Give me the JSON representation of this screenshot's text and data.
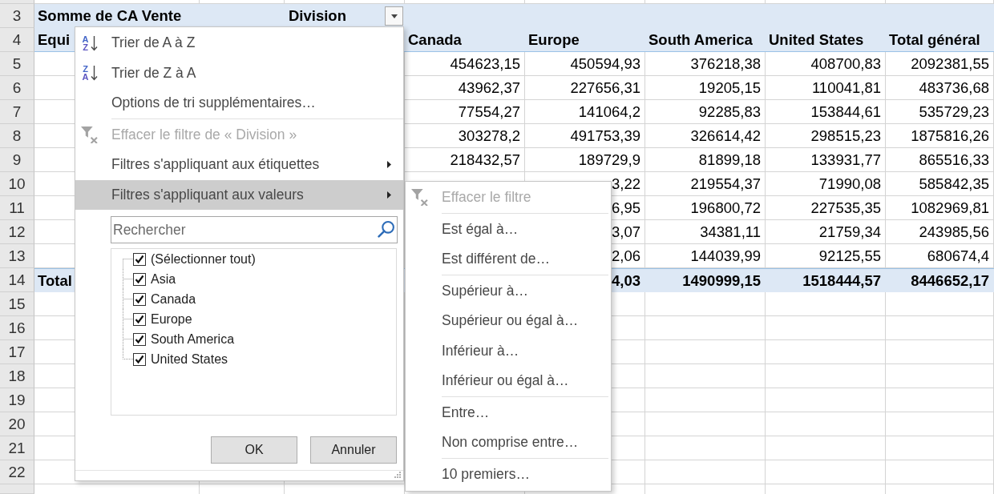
{
  "sheet": {
    "row_numbers": [
      "3",
      "4",
      "5",
      "6",
      "7",
      "8",
      "9",
      "10",
      "11",
      "12",
      "13",
      "14",
      "15",
      "16",
      "17",
      "18",
      "19",
      "20",
      "21",
      "22"
    ],
    "pivot": {
      "title": "Somme de CA Vente",
      "column_field": "Division",
      "row_field": "Equi",
      "columns": [
        "Canada",
        "Europe",
        "South America",
        "United States",
        "Total général"
      ],
      "rows": [
        {
          "values": [
            "454623,15",
            "450594,93",
            "376218,38",
            "408700,83",
            "2092381,55"
          ]
        },
        {
          "values": [
            "43962,37",
            "227656,31",
            "19205,15",
            "110041,81",
            "483736,68"
          ]
        },
        {
          "values": [
            "77554,27",
            "141064,2",
            "92285,83",
            "153844,61",
            "535729,23"
          ]
        },
        {
          "values": [
            "303278,2",
            "491753,39",
            "326614,42",
            "298515,23",
            "1875816,26"
          ]
        },
        {
          "values": [
            "218432,57",
            "189729,9",
            "81899,18",
            "133931,77",
            "865516,33"
          ]
        },
        {
          "values": [
            "3,22",
            "219554,37",
            "71990,08",
            "585842,35"
          ]
        },
        {
          "values": [
            "6,95",
            "196800,72",
            "227535,35",
            "1082969,81"
          ]
        },
        {
          "values": [
            "3,07",
            "34381,11",
            "21759,34",
            "243985,56"
          ]
        },
        {
          "values": [
            "2,06",
            "144039,99",
            "92125,55",
            "680674,4"
          ]
        }
      ],
      "total": {
        "label": "Total",
        "values": [
          "4,03",
          "1490999,15",
          "1518444,57",
          "8446652,17"
        ]
      }
    }
  },
  "filter_menu": {
    "sections": [
      [
        {
          "kind": "sort",
          "label": "Trier de A à Z",
          "icon_letters": [
            "A",
            "Z"
          ],
          "disabled": false,
          "selected": false,
          "submenu": false
        },
        {
          "kind": "sort",
          "label": "Trier de Z à A",
          "icon_letters": [
            "Z",
            "A"
          ],
          "disabled": false,
          "selected": false,
          "submenu": false
        },
        {
          "kind": "command",
          "label": "Options de tri supplémentaires…",
          "disabled": false,
          "selected": false,
          "submenu": false
        }
      ],
      [
        {
          "kind": "clear_filter",
          "label": "Effacer le filtre de « Division »",
          "disabled": true,
          "selected": false,
          "submenu": false
        },
        {
          "kind": "command",
          "label": "Filtres s'appliquant aux étiquettes",
          "disabled": false,
          "selected": false,
          "submenu": true
        },
        {
          "kind": "command",
          "label": "Filtres s'appliquant aux valeurs",
          "disabled": false,
          "selected": true,
          "submenu": true
        }
      ]
    ],
    "search": {
      "placeholder": "Rechercher"
    },
    "values": [
      {
        "label": "(Sélectionner tout)",
        "checked": true
      },
      {
        "label": "Asia",
        "checked": true
      },
      {
        "label": "Canada",
        "checked": true
      },
      {
        "label": "Europe",
        "checked": true
      },
      {
        "label": "South America",
        "checked": true
      },
      {
        "label": "United States",
        "checked": true
      }
    ],
    "buttons": [
      "OK",
      "Annuler"
    ],
    "submenu": {
      "sections": [
        [
          {
            "kind": "clear_filter",
            "label": "Effacer le filtre",
            "disabled": true,
            "selected": false,
            "submenu": false
          }
        ],
        [
          {
            "kind": "command",
            "label": "Est égal à…",
            "disabled": false,
            "selected": false,
            "submenu": false
          },
          {
            "kind": "command",
            "label": "Est différent de…",
            "disabled": false,
            "selected": false,
            "submenu": false
          }
        ],
        [
          {
            "kind": "command",
            "label": "Supérieur à…",
            "disabled": false,
            "selected": false,
            "submenu": false
          },
          {
            "kind": "command",
            "label": "Supérieur ou égal à…",
            "disabled": false,
            "selected": false,
            "submenu": false
          },
          {
            "kind": "command",
            "label": "Inférieur à…",
            "disabled": false,
            "selected": false,
            "submenu": false
          },
          {
            "kind": "command",
            "label": "Inférieur ou égal à…",
            "disabled": false,
            "selected": false,
            "submenu": false
          }
        ],
        [
          {
            "kind": "command",
            "label": "Entre…",
            "disabled": false,
            "selected": false,
            "submenu": false
          },
          {
            "kind": "command",
            "label": "Non comprise entre…",
            "disabled": false,
            "selected": false,
            "submenu": false
          }
        ],
        [
          {
            "kind": "command",
            "label": "10 premiers…",
            "disabled": false,
            "selected": false,
            "submenu": false
          }
        ]
      ]
    }
  }
}
